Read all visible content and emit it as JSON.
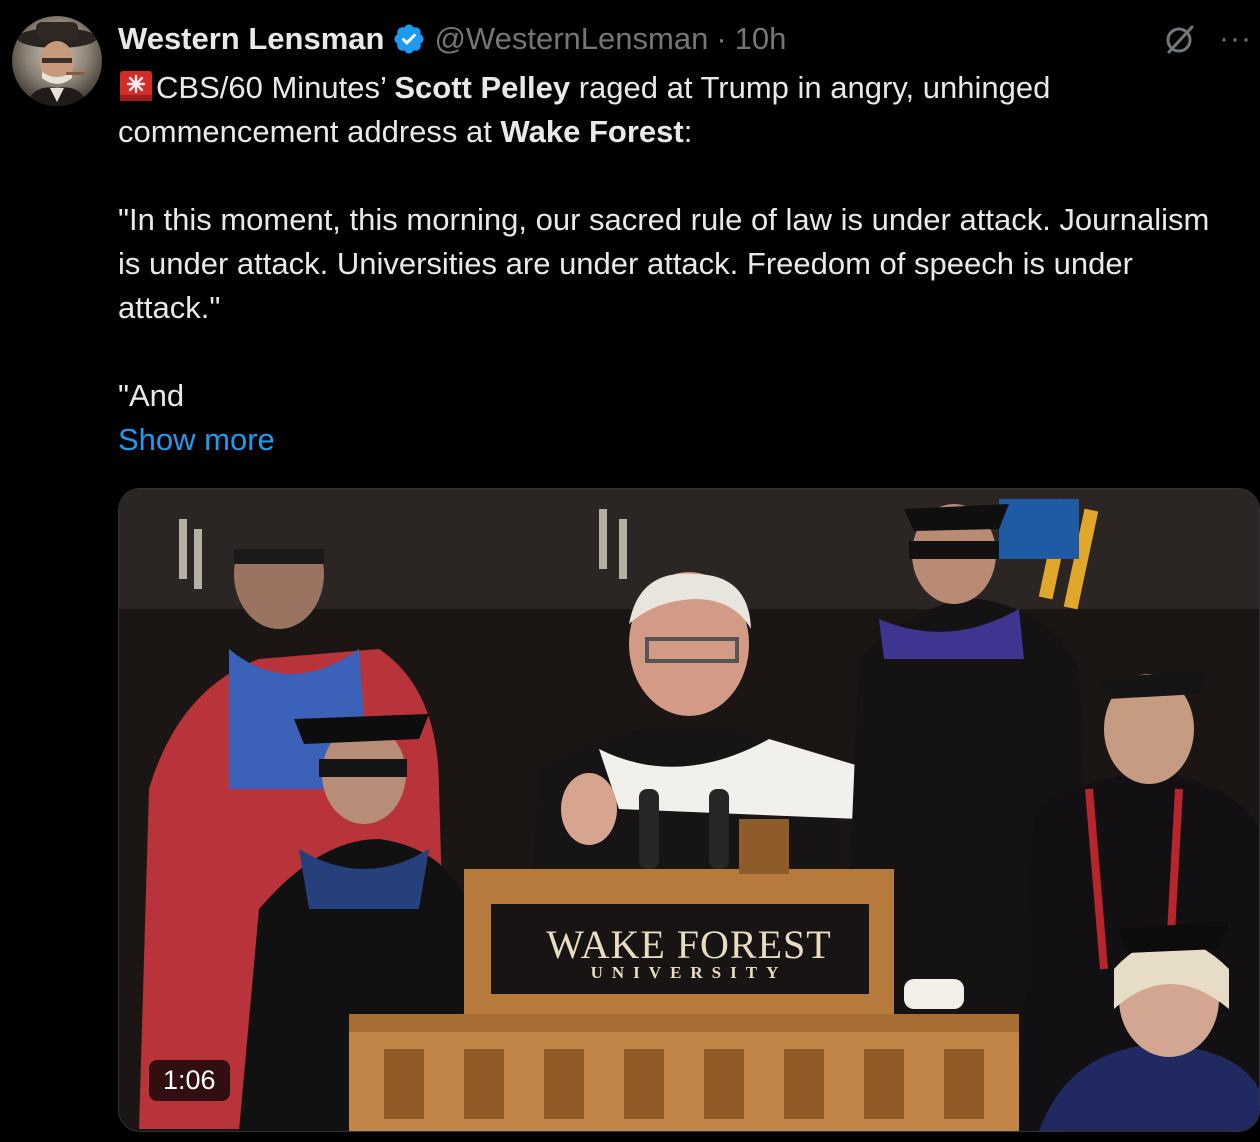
{
  "author": {
    "display_name": "Western Lensman",
    "handle": "@WesternLensman",
    "separator": "·",
    "time": "10h",
    "verified_color": "#1d9bf0"
  },
  "tweet": {
    "line1_prefix": "CBS/60 Minutes’ ",
    "line1_bold": "Scott Pelley",
    "line1_suffix": " raged at Trump in angry, unhinged commencement address at ",
    "line1_bold2": "Wake Forest",
    "line1_end": ":",
    "quote": "\"In this moment, this morning, our sacred rule of law is under attack. Journalism is under attack. Universities are under attack. Freedom of speech is under attack.\"",
    "truncated": "\"And",
    "show_more": "Show more"
  },
  "media": {
    "duration": "1:06",
    "podium_title": "WAKE FOREST",
    "podium_subtitle": "UNIVERSITY"
  },
  "icons": {
    "alert": "rotating-light-icon",
    "verified": "verified-badge-icon",
    "grok": "grok-icon",
    "more": "more-options-icon"
  },
  "colors": {
    "background": "#000000",
    "text": "#e7e9ea",
    "secondary": "#71767b",
    "link": "#1d9bf0"
  }
}
